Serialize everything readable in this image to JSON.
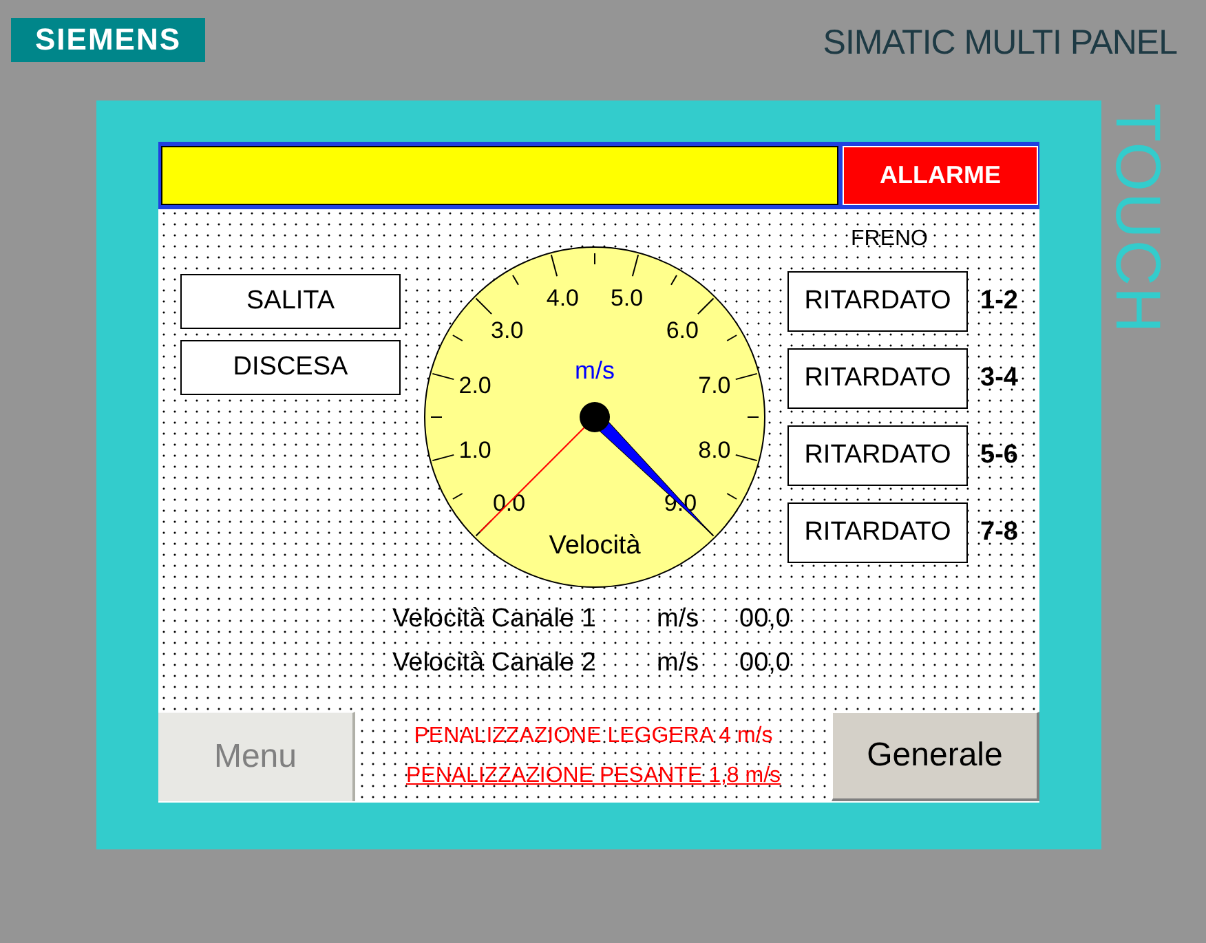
{
  "header": {
    "brand": "SIEMENS",
    "model": "SIMATIC MULTI PANEL",
    "side_label": "TOUCH"
  },
  "alarm_bar": {
    "button": "ALLARME"
  },
  "direction_buttons": [
    "SALITA",
    "DISCESA"
  ],
  "gauge": {
    "unit": "m/s",
    "title": "Velocità",
    "scale_labels": [
      "0.0",
      "1.0",
      "2.0",
      "3.0",
      "4.0",
      "5.0",
      "6.0",
      "7.0",
      "8.0",
      "9.0"
    ],
    "level": 1.0
  },
  "brakes": {
    "title": "FRENO",
    "rows": [
      {
        "button": "RITARDATO",
        "label": "1-2"
      },
      {
        "button": "RITARDATO",
        "label": "3-4"
      },
      {
        "button": "RITARDATO",
        "label": "5-6"
      },
      {
        "button": "RITARDATO",
        "label": "7-8"
      }
    ]
  },
  "readings": [
    {
      "label": "Velocità Canale 1",
      "unit": "m/s",
      "value": "00,0"
    },
    {
      "label": "Velocità Canale 2",
      "unit": "m/s",
      "value": "00,0"
    }
  ],
  "penalties": [
    {
      "text": "PENALIZZAZIONE LEGGERA 4 m/s",
      "underlined": false
    },
    {
      "text": "PENALIZZAZIONE PESANTE 1,8 m/s",
      "underlined": true
    }
  ],
  "menu_button": {
    "label": "Menu",
    "disabled": true
  },
  "general_button": "Generale"
}
